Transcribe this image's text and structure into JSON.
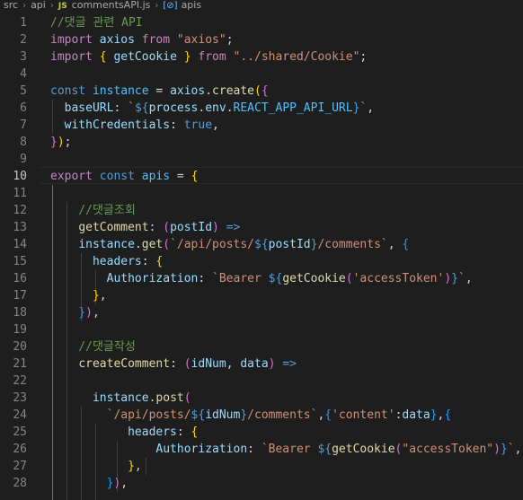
{
  "breadcrumb": {
    "items": [
      "src",
      "api",
      "commentsAPI.js",
      "apis"
    ],
    "file_icon": "JS",
    "symbol_icon": "[⊘]"
  },
  "editor": {
    "active_line": 10,
    "line_numbers": [
      "1",
      "2",
      "3",
      "4",
      "5",
      "6",
      "7",
      "8",
      "9",
      "10",
      "11",
      "12",
      "13",
      "14",
      "15",
      "16",
      "17",
      "18",
      "19",
      "20",
      "21",
      "22",
      "23",
      "24",
      "25",
      "26",
      "27",
      "28"
    ],
    "code": {
      "l1": "//댓글 관련 API",
      "l12": "//댓글조회",
      "l20": "//댓글작성"
    }
  }
}
